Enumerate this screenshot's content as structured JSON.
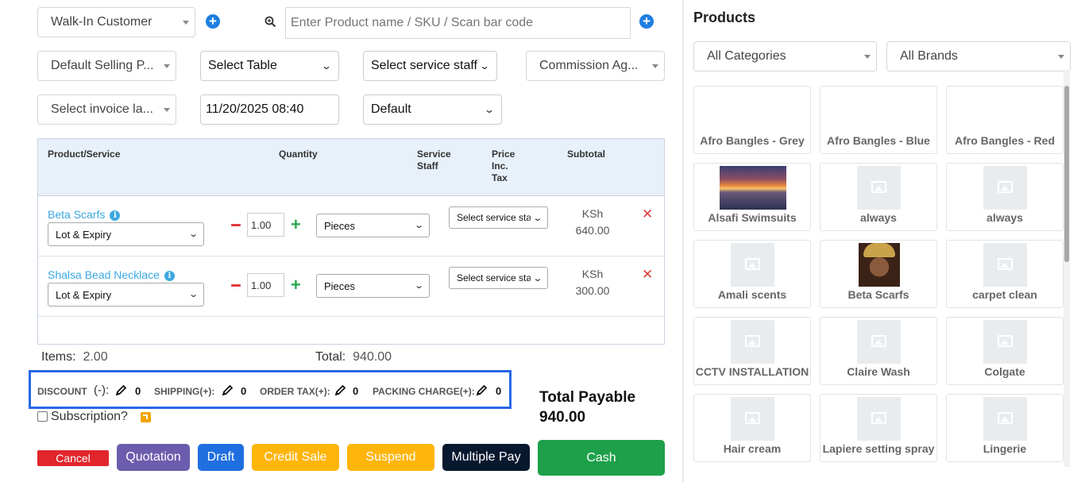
{
  "customer": {
    "value": "Walk-In Customer"
  },
  "search": {
    "placeholder": "Enter Product name / SKU / Scan bar code"
  },
  "filters": {
    "selling_price": "Default Selling P...",
    "table": "Select Table",
    "service_staff": "Select service staff",
    "commission_agent": "Commission Ag...",
    "invoice_layout": "Select invoice la...",
    "datetime": "11/20/2025 08:40",
    "invoice_scheme": "Default"
  },
  "table": {
    "headers": {
      "product": "Product/Service",
      "quantity": "Quantity",
      "service_staff": "Service Staff",
      "price": "Price Inc. Tax",
      "subtotal": "Subtotal"
    },
    "rows": [
      {
        "name": "Beta Scarfs",
        "lot": "Lot & Expiry",
        "qty": "1.00",
        "unit": "Pieces",
        "staff": "Select service sta",
        "currency": "KSh",
        "subtotal": "640.00"
      },
      {
        "name": "Shalsa Bead Necklace",
        "lot": "Lot & Expiry",
        "qty": "1.00",
        "unit": "Pieces",
        "staff": "Select service sta",
        "currency": "KSh",
        "subtotal": "300.00"
      }
    ]
  },
  "summary": {
    "items_label": "Items:",
    "items_value": "2.00",
    "total_label": "Total:",
    "total_value": "940.00"
  },
  "charges": {
    "discount_label": "DISCOUNT",
    "discount_sign": "(-):",
    "discount_value": "0",
    "shipping_label": "SHIPPING(+):",
    "shipping_value": "0",
    "order_tax_label": "ORDER TAX(+):",
    "order_tax_value": "0",
    "packing_label": "PACKING CHARGE(+):",
    "packing_value": "0"
  },
  "subscription": {
    "label": "Subscription?"
  },
  "total_payable": {
    "label": "Total Payable",
    "value": "940.00"
  },
  "buttons": {
    "cancel": "Cancel",
    "quotation": "Quotation",
    "draft": "Draft",
    "credit_sale": "Credit Sale",
    "suspend": "Suspend",
    "multiple_pay": "Multiple Pay",
    "cash": "Cash"
  },
  "colors": {
    "cancel": "#e0262c",
    "quotation": "#6c5cad",
    "draft": "#1f6fe0",
    "credit_sale": "#ffb50a",
    "suspend": "#ffb50a",
    "multiple_pay": "#08182f",
    "cash": "#1ea04a",
    "highlight": "#2767e6"
  },
  "products_panel": {
    "title": "Products",
    "category": "All Categories",
    "brand": "All Brands",
    "items": [
      {
        "name": "Afro Bangles - Grey",
        "image": "none"
      },
      {
        "name": "Afro Bangles - Blue",
        "image": "none"
      },
      {
        "name": "Afro Bangles - Red",
        "image": "none"
      },
      {
        "name": "Alsafi Swimsuits",
        "image": "sunset-photo"
      },
      {
        "name": "always",
        "image": "placeholder"
      },
      {
        "name": "always",
        "image": "placeholder"
      },
      {
        "name": "Amali scents",
        "image": "placeholder"
      },
      {
        "name": "Beta Scarfs",
        "image": "portrait-photo"
      },
      {
        "name": "carpet clean",
        "image": "placeholder"
      },
      {
        "name": "CCTV INSTALLATION",
        "image": "placeholder"
      },
      {
        "name": "Claire Wash",
        "image": "placeholder"
      },
      {
        "name": "Colgate",
        "image": "placeholder"
      },
      {
        "name": "Hair cream",
        "image": "placeholder"
      },
      {
        "name": "Lapiere setting spray",
        "image": "placeholder"
      },
      {
        "name": "Lingerie",
        "image": "placeholder"
      }
    ]
  }
}
